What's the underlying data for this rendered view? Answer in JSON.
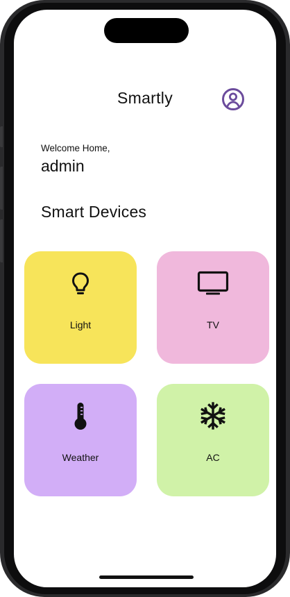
{
  "app": {
    "title": "Smartly",
    "profile_icon": "account-circle-icon",
    "accent_color": "#6b4b9c"
  },
  "welcome": {
    "greeting": "Welcome Home,",
    "user_name": "admin"
  },
  "devices_section": {
    "title": "Smart Devices",
    "devices": [
      {
        "label": "Light",
        "icon": "lightbulb-icon",
        "color": "#f7e45a"
      },
      {
        "label": "TV",
        "icon": "tv-icon",
        "color": "#f0b8dc"
      },
      {
        "label": "Weather",
        "icon": "thermometer-icon",
        "color": "#d2aef7"
      },
      {
        "label": "AC",
        "icon": "snowflake-icon",
        "color": "#d0f2a8"
      }
    ]
  }
}
